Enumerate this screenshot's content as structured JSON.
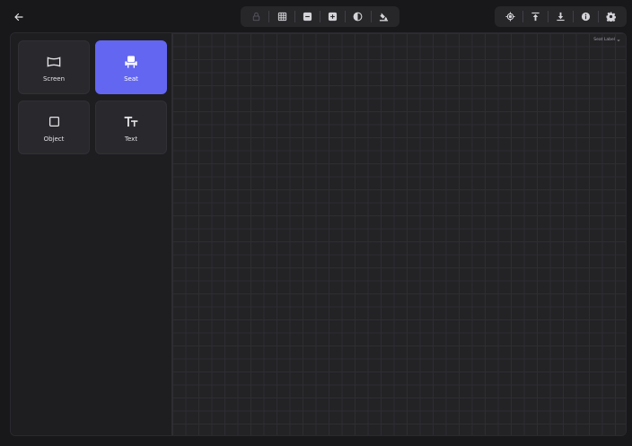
{
  "header": {
    "back_icon": "arrow-left-icon",
    "center_tools": [
      {
        "name": "lock-icon",
        "enabled": false
      },
      {
        "name": "grid-icon",
        "enabled": true
      },
      {
        "name": "zoom-out-icon",
        "enabled": true
      },
      {
        "name": "zoom-in-icon",
        "enabled": true
      },
      {
        "name": "contrast-icon",
        "enabled": true
      },
      {
        "name": "fill-color-icon",
        "enabled": true
      }
    ],
    "right_tools": [
      {
        "name": "target-icon"
      },
      {
        "name": "upload-icon"
      },
      {
        "name": "download-icon"
      },
      {
        "name": "info-icon"
      },
      {
        "name": "settings-icon"
      }
    ]
  },
  "sidebar": {
    "tiles": [
      {
        "label": "Screen",
        "icon": "screen-icon",
        "active": false
      },
      {
        "label": "Seat",
        "icon": "seat-icon",
        "active": true
      },
      {
        "label": "Object",
        "icon": "square-icon",
        "active": false
      },
      {
        "label": "Text",
        "icon": "text-icon",
        "active": false
      }
    ]
  },
  "canvas": {
    "seat_label_toggle": "Seat Label",
    "seat_label_chevron": "chevron-down-icon"
  },
  "colors": {
    "accent": "#6366f1",
    "background": "#18181b",
    "panel": "#1f1f23"
  }
}
